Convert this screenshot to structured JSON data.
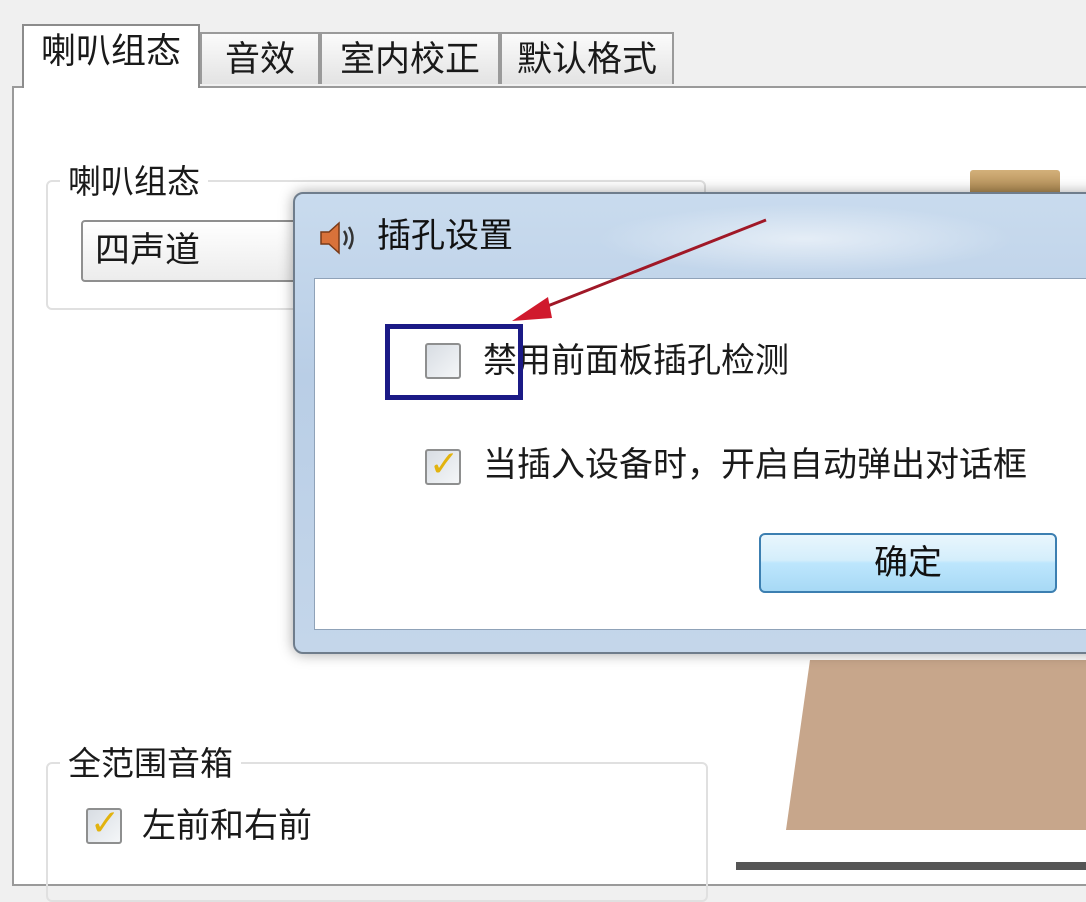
{
  "tabs": [
    {
      "label": "喇叭组态",
      "active": true
    },
    {
      "label": "音效",
      "active": false
    },
    {
      "label": "室内校正",
      "active": false
    },
    {
      "label": "默认格式",
      "active": false
    }
  ],
  "speaker_config": {
    "group_title": "喇叭组态",
    "selected_value": "四声道"
  },
  "full_range": {
    "group_title": "全范围音箱",
    "front_left_right_label": "左前和右前",
    "front_left_right_checked": true
  },
  "dialog": {
    "title": "插孔设置",
    "disable_front_panel_label": "禁用前面板插孔检测",
    "disable_front_panel_checked": false,
    "auto_popup_label": "当插入设备时，开启自动弹出对话框",
    "auto_popup_checked": true,
    "ok_label": "确定"
  },
  "annotation": {
    "highlight_color": "#1b1a86",
    "arrow_color": "#c0192a"
  },
  "checkmark_glyph": "✓"
}
